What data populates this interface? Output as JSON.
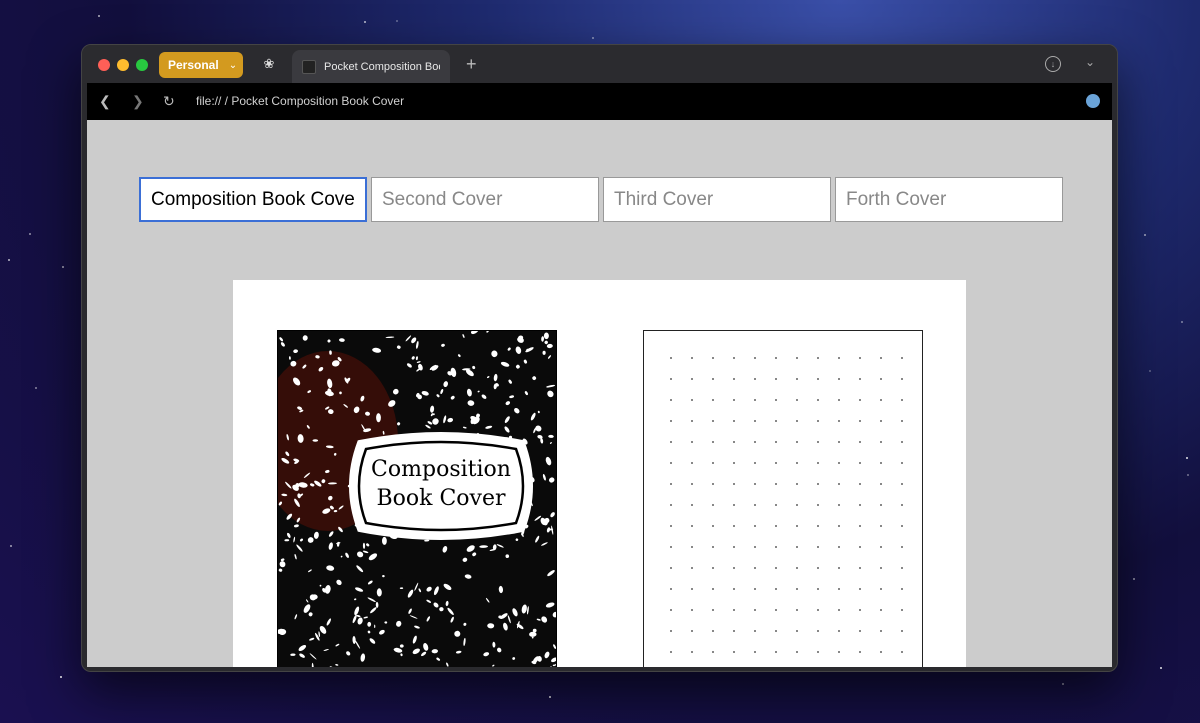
{
  "browser": {
    "profile_label": "Personal",
    "tab_title": "Pocket Composition Book Cover",
    "address": "file:// / Pocket Composition Book Cover"
  },
  "inputs": [
    {
      "value": "Composition Book Cover",
      "placeholder": ""
    },
    {
      "value": "",
      "placeholder": "Second Cover"
    },
    {
      "value": "",
      "placeholder": "Third Cover"
    },
    {
      "value": "",
      "placeholder": "Forth Cover"
    }
  ],
  "cover": {
    "title_line1": "Composition",
    "title_line2": "Book Cover"
  },
  "icons": {
    "back": "chevron-left-icon",
    "forward": "chevron-right-icon",
    "reload": "reload-icon",
    "new_tab": "plus-icon",
    "downloads": "download-icon",
    "tab_menu": "chevron-down-icon"
  },
  "colors": {
    "profile": "#d39a1f",
    "focus_border": "#3b6fd6",
    "viewport_bg": "#cccccc"
  }
}
